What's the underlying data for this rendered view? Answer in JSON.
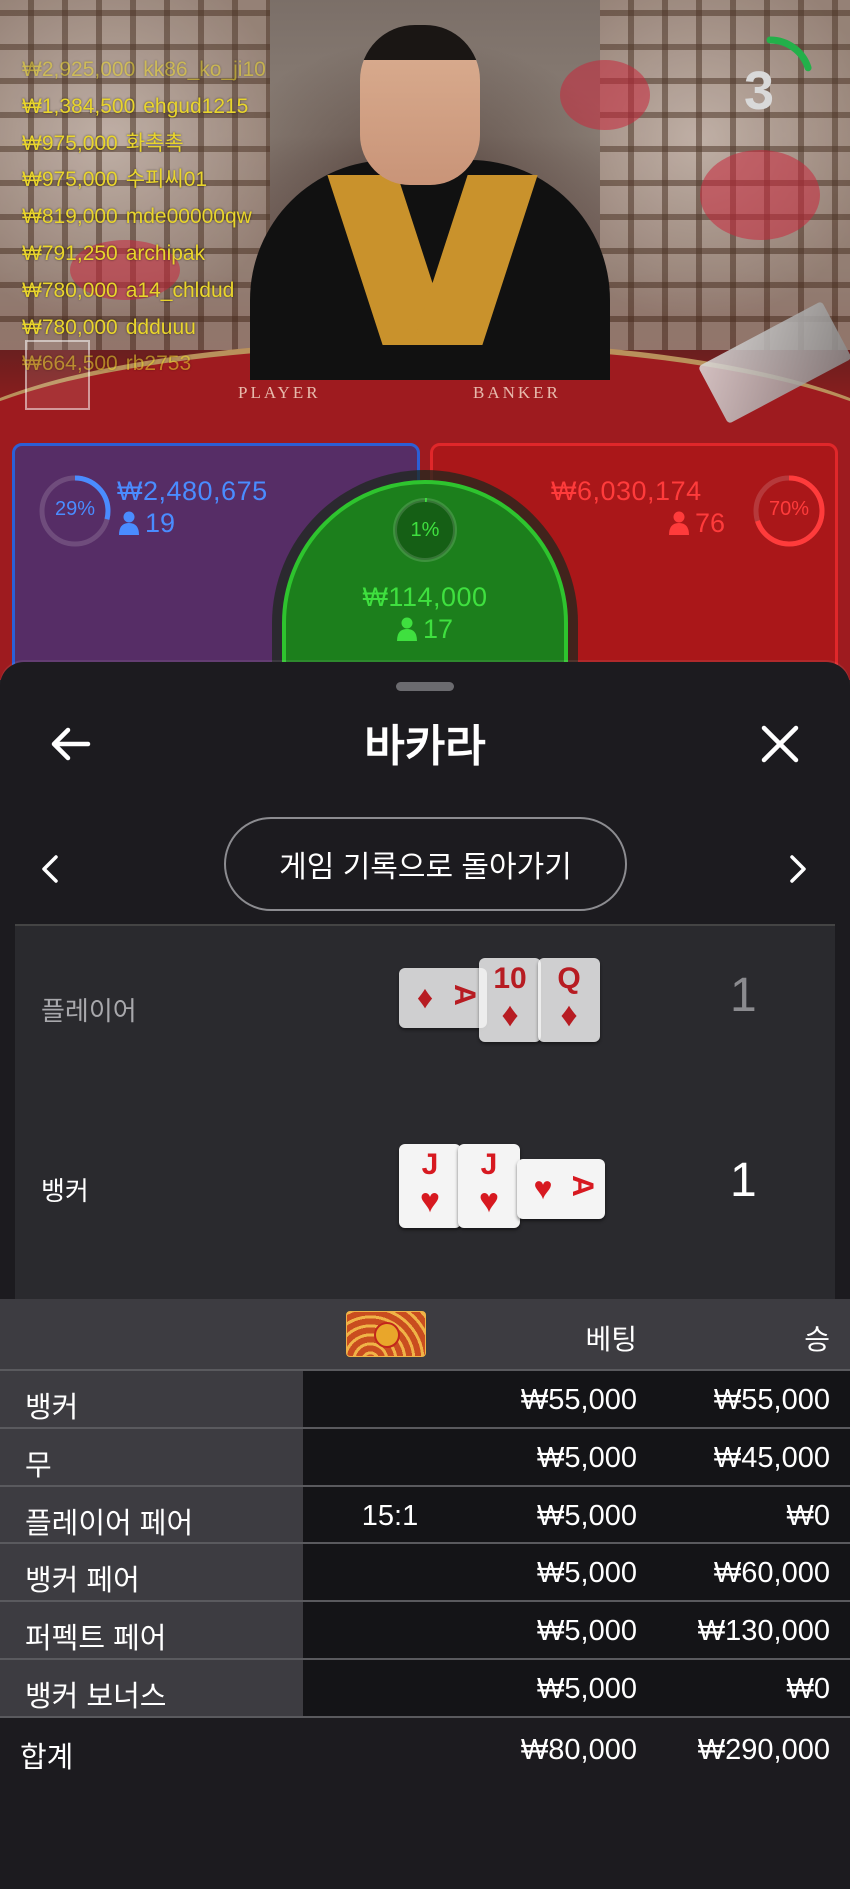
{
  "leaderboard": [
    {
      "amount": "₩2,925,000",
      "user": "kk86_ko_ji10",
      "faded": true
    },
    {
      "amount": "₩1,384,500",
      "user": "ehgud1215"
    },
    {
      "amount": "₩975,000",
      "user": "화촉촉"
    },
    {
      "amount": "₩975,000",
      "user": "수피씨01"
    },
    {
      "amount": "₩819,000",
      "user": "mde00000qw"
    },
    {
      "amount": "₩791,250",
      "user": "archipak"
    },
    {
      "amount": "₩780,000",
      "user": "a14_chldud"
    },
    {
      "amount": "₩780,000",
      "user": "ddduuu"
    },
    {
      "amount": "₩664,500",
      "user": "rb2753",
      "faded": true
    }
  ],
  "timer": {
    "seconds": "3",
    "remaining_fraction": 0.2,
    "color": "#23b04a"
  },
  "table": {
    "player_word": "PLAYER",
    "banker_word": "BANKER"
  },
  "bets": {
    "player": {
      "percent": "29%",
      "percent_value": 0.29,
      "amount": "₩2,480,675",
      "count": "19",
      "color": "#4a8cff"
    },
    "banker": {
      "percent": "70%",
      "percent_value": 0.7,
      "amount": "₩6,030,174",
      "count": "76",
      "color": "#ff3b3b"
    },
    "tie": {
      "percent": "1%",
      "percent_value": 0.01,
      "amount": "₩114,000",
      "count": "17",
      "color": "#3fe03f"
    }
  },
  "sheet": {
    "title": "바카라",
    "history_button": "게임 기록으로 돌아가기",
    "player_label": "플레이어",
    "banker_label": "뱅커",
    "player_score": "1",
    "banker_score": "1",
    "player_cards": [
      {
        "rank": "A",
        "suit": "♦",
        "orientation": "sideways"
      },
      {
        "rank": "10",
        "suit": "♦",
        "orientation": "upright"
      },
      {
        "rank": "Q",
        "suit": "♦",
        "orientation": "upright"
      }
    ],
    "banker_cards": [
      {
        "rank": "J",
        "suit": "♥",
        "orientation": "upright"
      },
      {
        "rank": "J",
        "suit": "♥",
        "orientation": "upright"
      },
      {
        "rank": "A",
        "suit": "♥",
        "orientation": "sideways"
      }
    ]
  },
  "payouts": {
    "headers": {
      "bet": "베팅",
      "win": "승"
    },
    "rows": [
      {
        "label": "뱅커",
        "odds": "",
        "bet": "₩55,000",
        "win": "₩55,000"
      },
      {
        "label": "무",
        "odds": "",
        "bet": "₩5,000",
        "win": "₩45,000"
      },
      {
        "label": "플레이어 페어",
        "odds": "15:1",
        "bet": "₩5,000",
        "win": "₩0"
      },
      {
        "label": "뱅커 페어",
        "odds": "",
        "bet": "₩5,000",
        "win": "₩60,000"
      },
      {
        "label": "퍼펙트 페어",
        "odds": "",
        "bet": "₩5,000",
        "win": "₩130,000"
      },
      {
        "label": "뱅커 보너스",
        "odds": "",
        "bet": "₩5,000",
        "win": "₩0"
      }
    ],
    "total": {
      "label": "합계",
      "bet": "₩80,000",
      "win": "₩290,000"
    }
  }
}
